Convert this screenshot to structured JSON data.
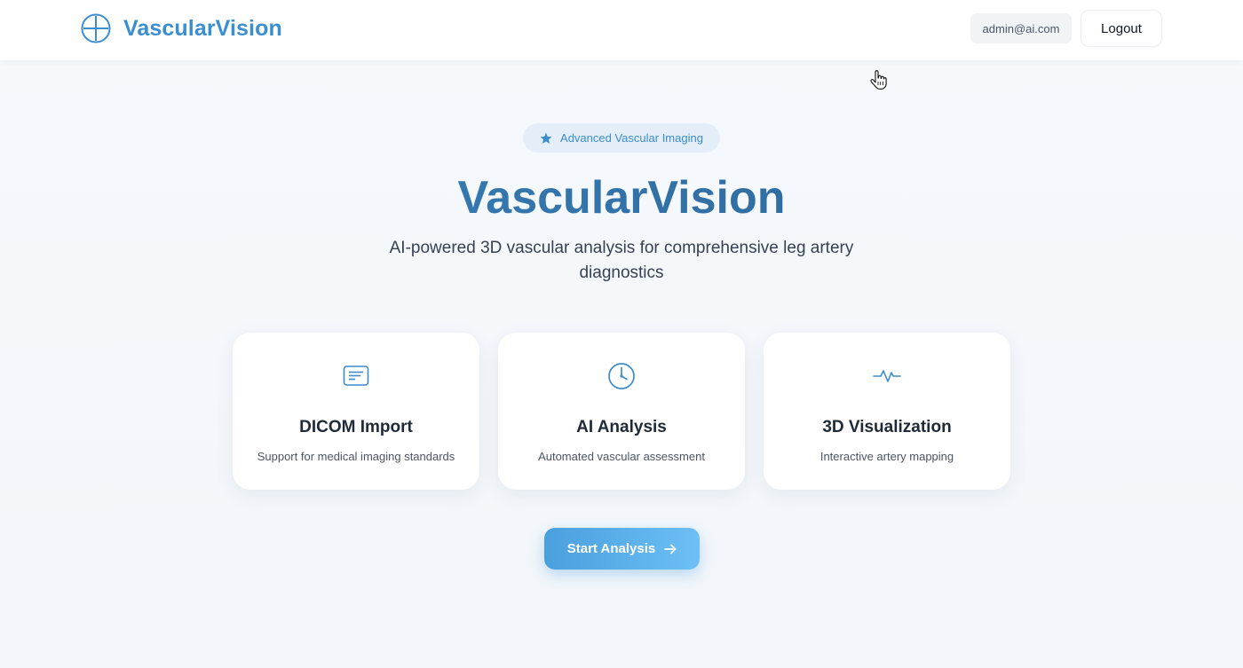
{
  "header": {
    "brand_name": "VascularVision",
    "brand_icon": "circle-plus-icon",
    "user_email": "admin@ai.com",
    "logout_label": "Logout"
  },
  "hero": {
    "badge_label": "Advanced Vascular Imaging",
    "badge_icon": "star-icon",
    "title": "VascularVision",
    "subtitle": "AI-powered 3D vascular analysis for comprehensive leg artery diagnostics"
  },
  "features": [
    {
      "icon": "document-icon",
      "title": "DICOM Import",
      "description": "Support for medical imaging standards"
    },
    {
      "icon": "clock-icon",
      "title": "AI Analysis",
      "description": "Automated vascular assessment"
    },
    {
      "icon": "pulse-icon",
      "title": "3D Visualization",
      "description": "Interactive artery mapping"
    }
  ],
  "cta": {
    "label": "Start Analysis",
    "icon": "arrow-right-icon"
  },
  "colors": {
    "brand": "#3b8fd0",
    "accent_gradient_start": "#4a9fde",
    "accent_gradient_end": "#6cc0f5",
    "title_gradient_start": "#3a86c2",
    "title_gradient_end": "#2b5f8f",
    "badge_bg": "#e3eef8"
  }
}
